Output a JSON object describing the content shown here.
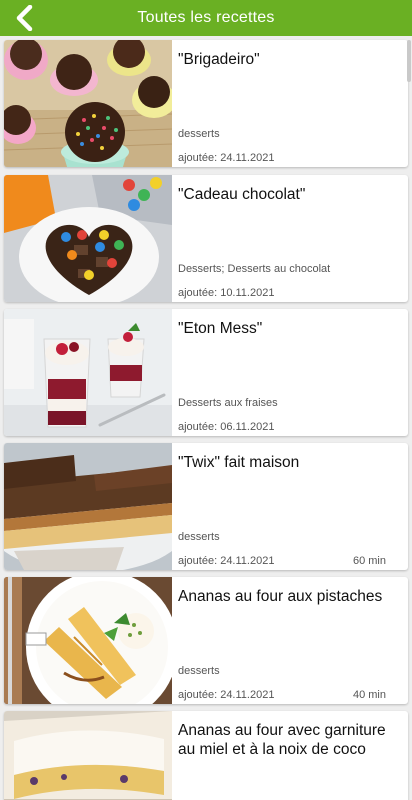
{
  "appbar": {
    "title": "Toutes les recettes",
    "back_icon": "chevron-left-icon",
    "color": "#6ab023"
  },
  "recipes": [
    {
      "title": "\"Brigadeiro\"",
      "category": "desserts",
      "date": "ajoutée: 24.11.2021",
      "time": ""
    },
    {
      "title": "\"Cadeau chocolat\"",
      "category": "Desserts; Desserts au chocolat",
      "date": "ajoutée: 10.11.2021",
      "time": ""
    },
    {
      "title": "\"Eton Mess\"",
      "category": "Desserts aux fraises",
      "date": "ajoutée: 06.11.2021",
      "time": ""
    },
    {
      "title": "\"Twix\" fait maison",
      "category": "desserts",
      "date": "ajoutée: 24.11.2021",
      "time": "60 min"
    },
    {
      "title": "Ananas au four aux pistaches",
      "category": "desserts",
      "date": "ajoutée: 24.11.2021",
      "time": "40 min"
    },
    {
      "title": "Ananas au four avec garniture au miel et à la noix de coco",
      "category": "",
      "date": "",
      "time": ""
    }
  ]
}
